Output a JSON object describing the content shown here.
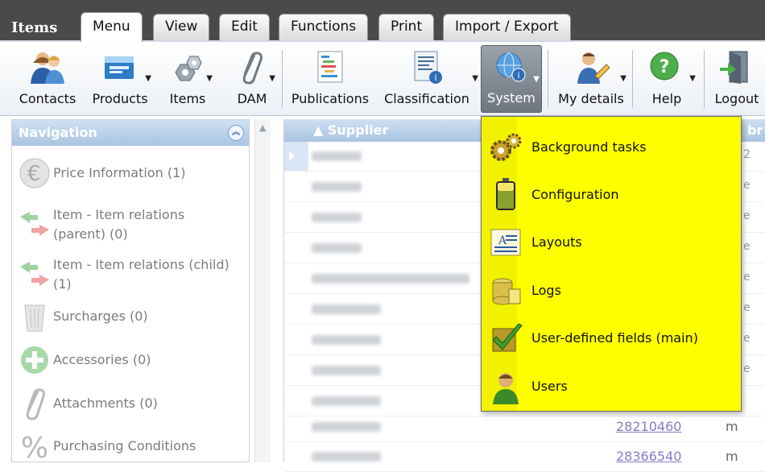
{
  "app": {
    "title": "Items"
  },
  "tabs": [
    "Menu",
    "View",
    "Edit",
    "Functions",
    "Print",
    "Import / Export"
  ],
  "ribbon": {
    "contacts": "Contacts",
    "products": "Products",
    "items": "Items",
    "dam": "DAM",
    "publications": "Publications",
    "classification": "Classification",
    "system": "System",
    "my_details": "My details",
    "help": "Help",
    "logout": "Logout"
  },
  "navigation": {
    "title": "Navigation",
    "items": [
      {
        "line1": "Price Information (1)",
        "line2": ""
      },
      {
        "line1": "Item - Item relations",
        "line2": "(parent) (0)"
      },
      {
        "line1": "Item - Item relations (child)",
        "line2": "(1)"
      },
      {
        "line1": "Surcharges (0)",
        "line2": ""
      },
      {
        "line1": "Accessories (0)",
        "line2": ""
      },
      {
        "line1": "Attachments (0)",
        "line2": ""
      },
      {
        "line1": "Purchasing Conditions",
        "line2": ""
      }
    ]
  },
  "grid": {
    "header_supplier": "Supplier",
    "header_partial": "br",
    "row_links": [
      "28210460",
      "28366540"
    ],
    "row_units": [
      "m",
      "m"
    ],
    "row_edge": [
      "2",
      "e",
      "e",
      "e",
      "e",
      "e",
      "e",
      "e"
    ]
  },
  "system_menu": {
    "items": [
      {
        "label": "Background tasks",
        "icon": "gears-icon"
      },
      {
        "label": "Configuration",
        "icon": "battery-icon"
      },
      {
        "label": "Layouts",
        "icon": "layout-icon"
      },
      {
        "label": "Logs",
        "icon": "logs-icon"
      },
      {
        "label": "User-defined fields (main)",
        "icon": "checkmark-box-icon"
      },
      {
        "label": "Users",
        "icon": "user-icon"
      }
    ]
  },
  "colors": {
    "menu_bg": "#ffff00",
    "nav_header": "#a9c4e2",
    "link": "#8a79c4"
  }
}
